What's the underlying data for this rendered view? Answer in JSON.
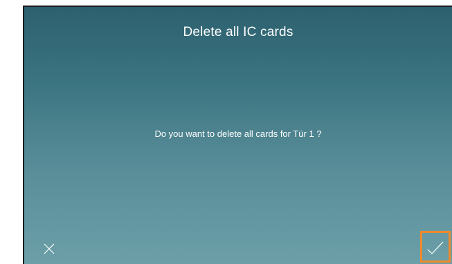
{
  "dialog": {
    "title": "Delete all IC cards",
    "message": "Do you want to delete all cards for Tür 1 ?",
    "cancel_icon": "close-icon",
    "confirm_icon": "checkmark-icon",
    "highlight_color": "#f08a2c"
  }
}
